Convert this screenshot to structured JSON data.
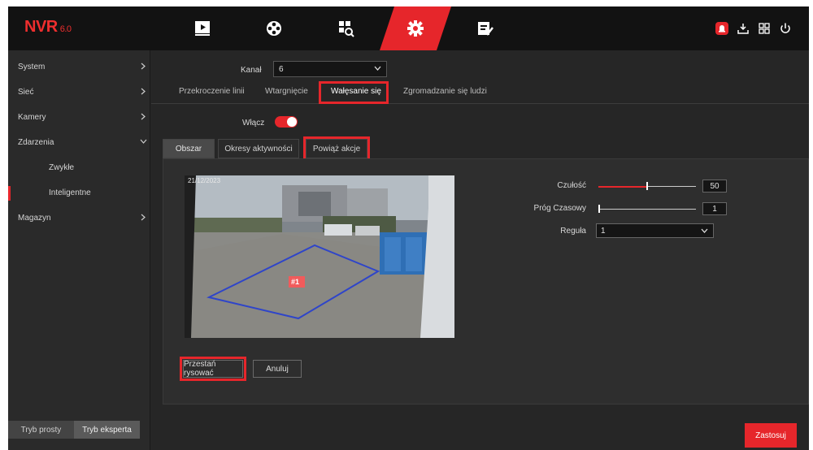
{
  "app": {
    "logo": "NVR",
    "version": "6.0"
  },
  "topnav": {
    "items": [
      {
        "id": "playback",
        "icon": "playback-icon"
      },
      {
        "id": "cameras",
        "icon": "film-reel-icon"
      },
      {
        "id": "search",
        "icon": "search-icon"
      },
      {
        "id": "settings",
        "icon": "gear-icon",
        "active": true
      },
      {
        "id": "maintenance",
        "icon": "maintenance-icon"
      }
    ],
    "right_icons": [
      "alarm-icon",
      "download-icon",
      "multi-screen-icon",
      "power-icon"
    ],
    "accent": "#e6262b"
  },
  "sidebar": {
    "items": [
      {
        "label": "System"
      },
      {
        "label": "Sieć"
      },
      {
        "label": "Kamery"
      },
      {
        "label": "Zdarzenia"
      },
      {
        "label": "Zwykłe"
      },
      {
        "label": "Inteligentne"
      },
      {
        "label": "Magazyn"
      }
    ],
    "modes": {
      "simple": "Tryb prosty",
      "expert": "Tryb eksperta"
    }
  },
  "main": {
    "channel_label": "Kanał",
    "channel_value": "6",
    "tabs": [
      {
        "label": "Przekroczenie linii"
      },
      {
        "label": "Wtargnięcie"
      },
      {
        "label": "Wałęsanie się"
      },
      {
        "label": "Zgromadzanie się ludzi"
      }
    ],
    "enable_label": "Włącz",
    "subtabs": [
      {
        "label": "Obszar"
      },
      {
        "label": "Okresy aktywności"
      },
      {
        "label": "Powiąż akcje"
      }
    ],
    "video": {
      "timestamp": "21/12/2023",
      "zone_label": "#1"
    },
    "controls": {
      "sensitivity_label": "Czułość",
      "sensitivity_value": "50",
      "sensitivity_fraction": 0.5,
      "threshold_label": "Próg Czasowy",
      "threshold_value": "1",
      "threshold_fraction": 0.0,
      "rule_label": "Reguła",
      "rule_value": "1"
    },
    "buttons": {
      "stop_drawing": "Przestań rysować",
      "cancel": "Anuluj",
      "apply": "Zastosuj"
    }
  }
}
